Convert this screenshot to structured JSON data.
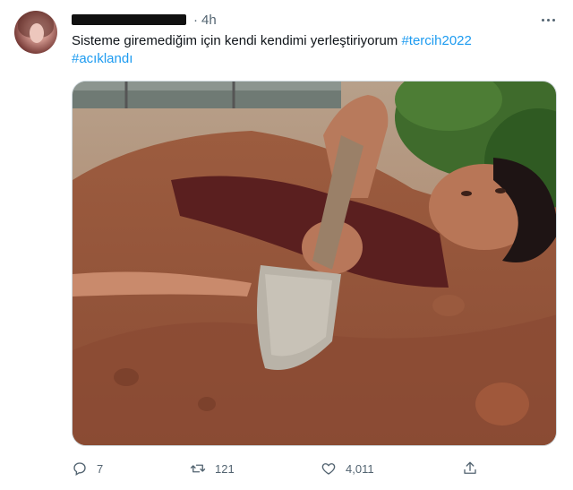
{
  "tweet": {
    "time": "4h",
    "separator": "·",
    "text_main": "Sisteme giremediğim için kendi kendimi yerleştiriyorum ",
    "hashtag_1": "#tercih2022",
    "hashtag_2": "#acıklandı",
    "more_icon": "ellipsis-icon",
    "photo_description_icon": "photo"
  },
  "actions": {
    "reply_count": "7",
    "retweet_count": "121",
    "like_count": "4,011",
    "reply_icon": "reply-icon",
    "retweet_icon": "retweet-icon",
    "like_icon": "heart-icon",
    "share_icon": "share-icon"
  },
  "colors": {
    "link": "#1d9bf0",
    "secondary": "#536471",
    "text": "#0f1419"
  }
}
